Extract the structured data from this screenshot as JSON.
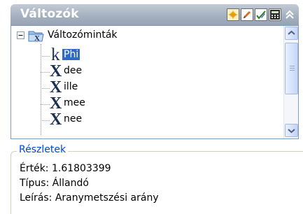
{
  "panel": {
    "title": "Változók"
  },
  "tree": {
    "root_label": "Változóminták",
    "items": [
      {
        "label": "Phi",
        "icon": "k",
        "selected": true
      },
      {
        "label": "dee",
        "icon": "X",
        "selected": false
      },
      {
        "label": "ille",
        "icon": "X",
        "selected": false
      },
      {
        "label": "mee",
        "icon": "X",
        "selected": false
      },
      {
        "label": "nee",
        "icon": "X",
        "selected": false
      }
    ]
  },
  "details": {
    "legend": "Részletek",
    "value_line": "Érték: 1.61803399",
    "type_line": "Típus: Állandó",
    "desc_line": "Leírás: Aranymetszési arány"
  },
  "colors": {
    "selection": "#316ac5",
    "legend": "#0046d5",
    "titlebar": "#a6b1c0"
  }
}
